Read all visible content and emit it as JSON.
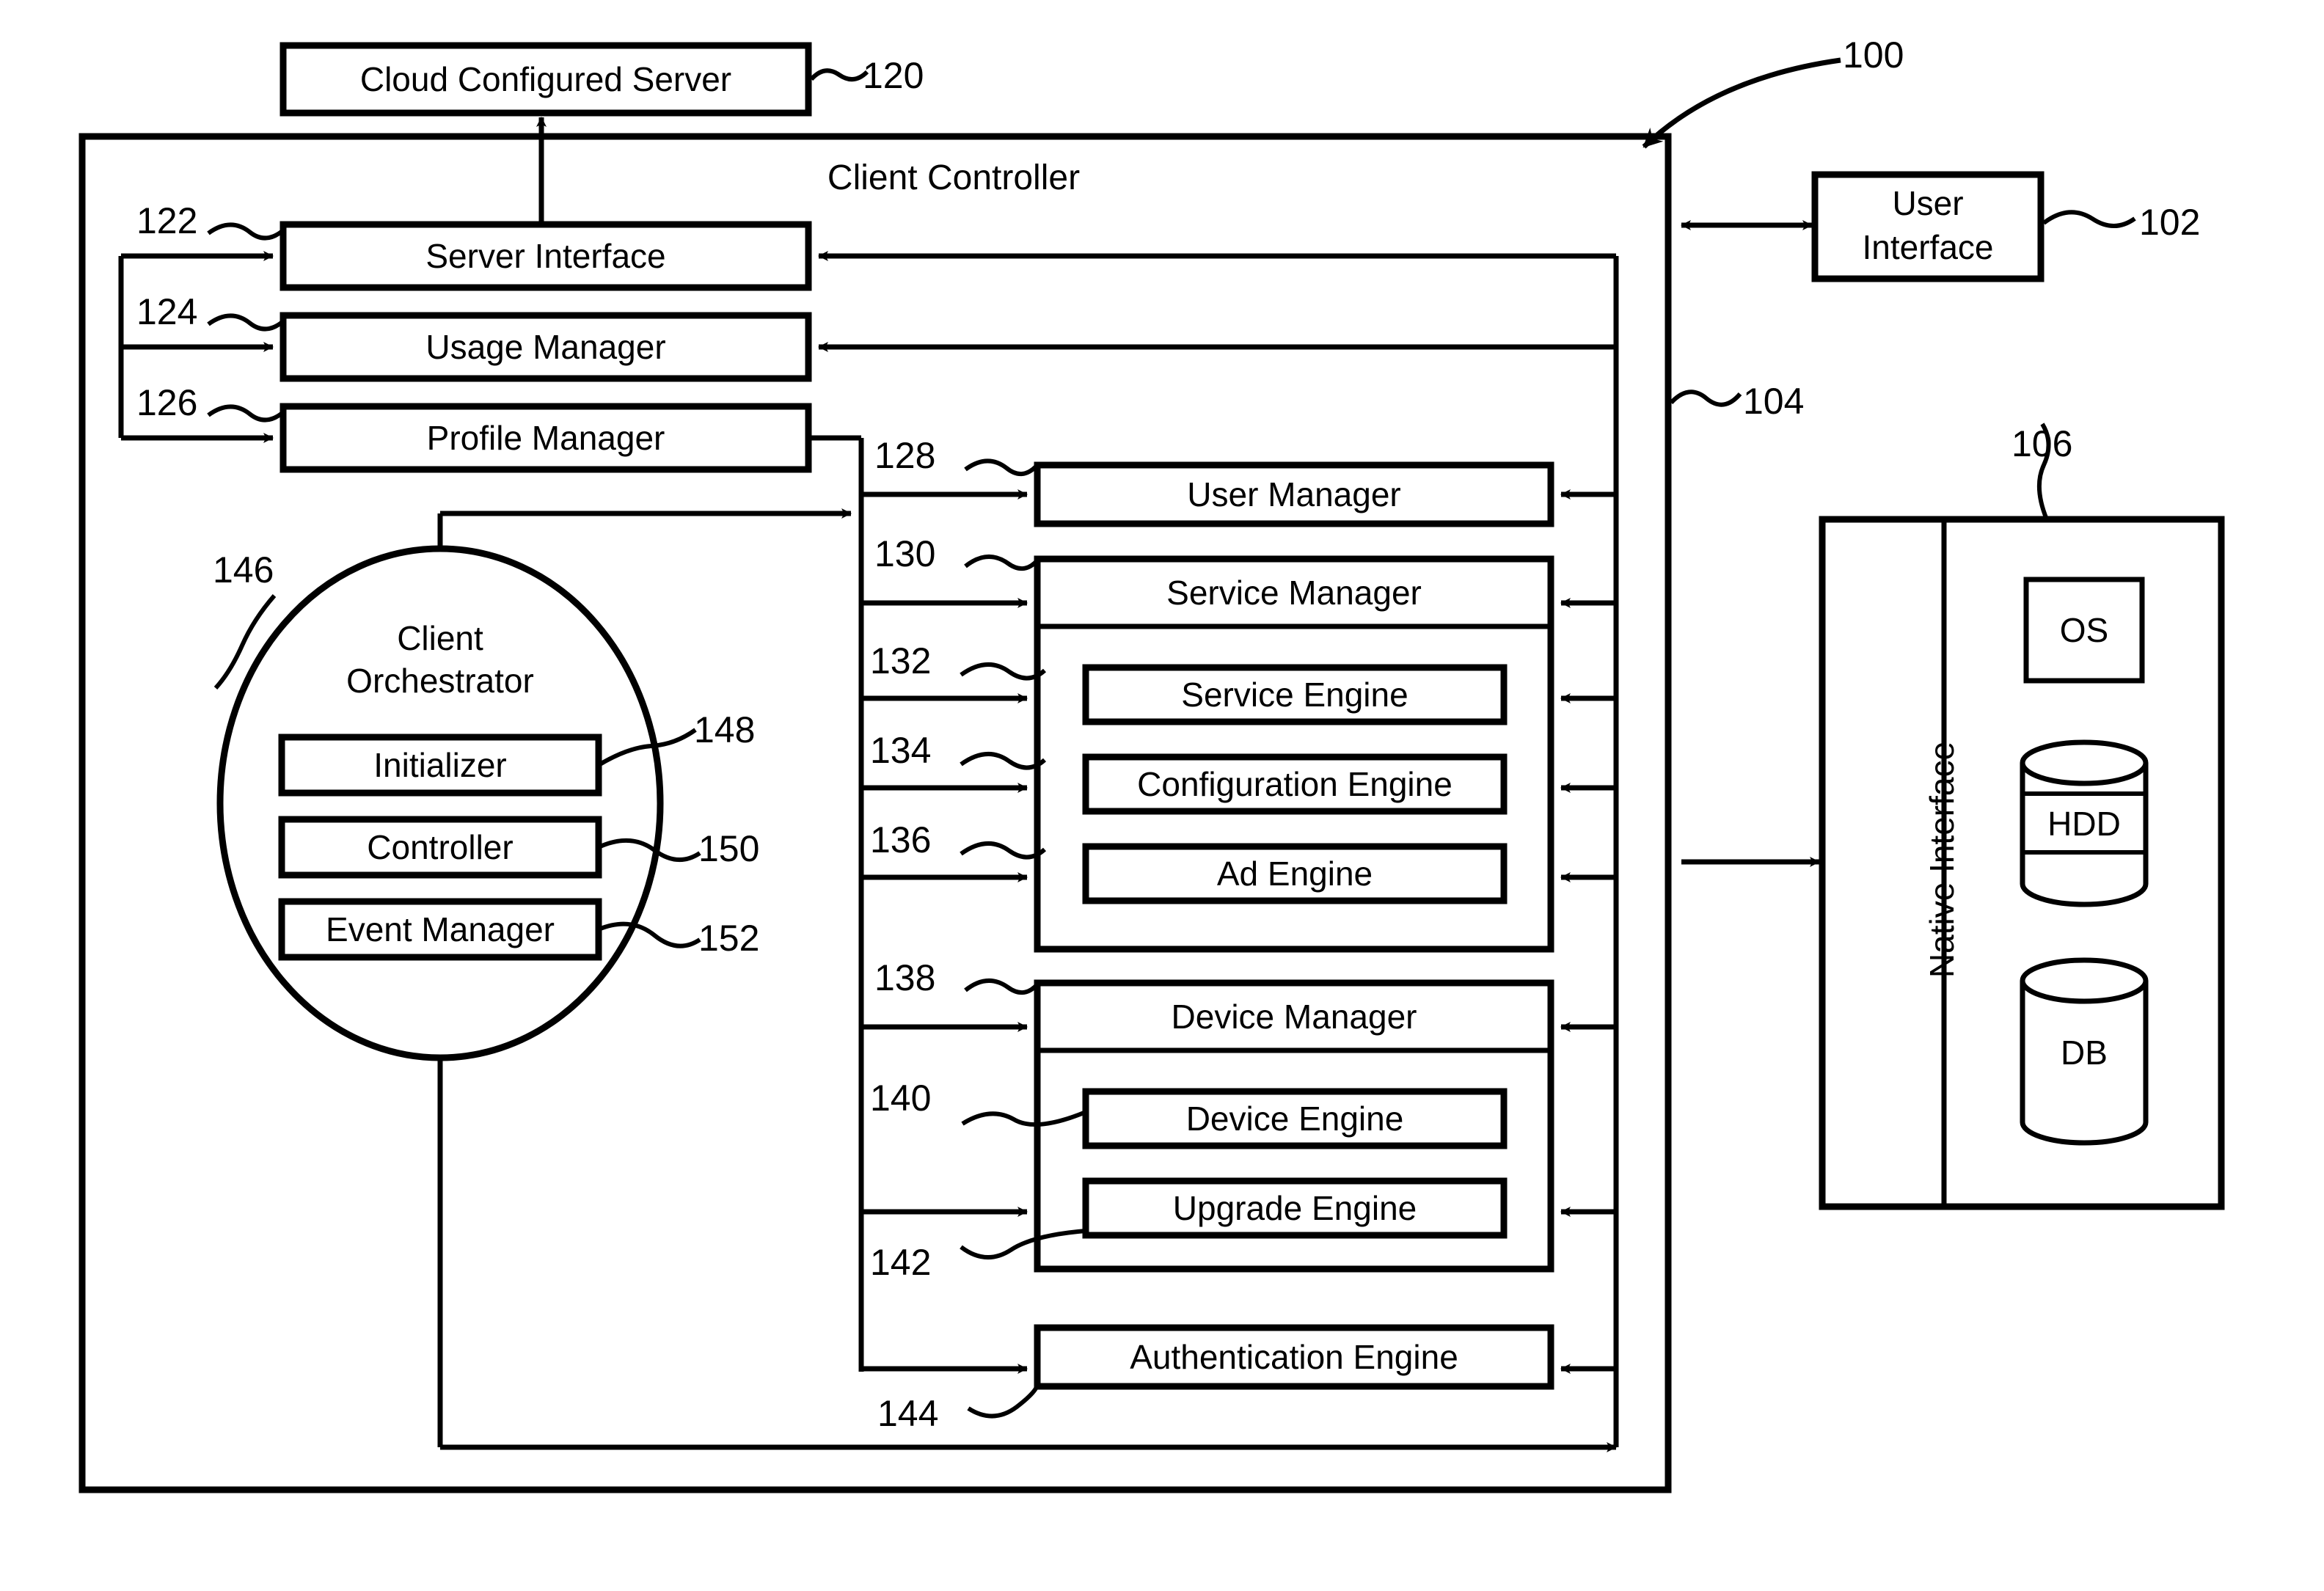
{
  "figure": {
    "reference_number": "100",
    "outer_label": "100"
  },
  "cloud_server": {
    "label": "Cloud Configured Server",
    "ref": "120"
  },
  "client_controller": {
    "title": "Client Controller",
    "ref": "104"
  },
  "user_interface": {
    "label_line1": "User",
    "label_line2": "Interface",
    "ref": "102"
  },
  "native_system": {
    "interface_label": "Native Interface",
    "ref": "106",
    "components": [
      {
        "label": "OS",
        "shape": "rect"
      },
      {
        "label": "HDD",
        "shape": "cylinder"
      },
      {
        "label": "DB",
        "shape": "cylinder"
      }
    ]
  },
  "left_column": [
    {
      "label": "Server Interface",
      "ref": "122"
    },
    {
      "label": "Usage Manager",
      "ref": "124"
    },
    {
      "label": "Profile Manager",
      "ref": "126"
    }
  ],
  "orchestrator": {
    "title_line1": "Client",
    "title_line2": "Orchestrator",
    "ref": "146",
    "items": [
      {
        "label": "Initializer",
        "ref": "148"
      },
      {
        "label": "Controller",
        "ref": "150"
      },
      {
        "label": "Event Manager",
        "ref": "152"
      }
    ]
  },
  "right_column": {
    "user_manager": {
      "label": "User Manager",
      "ref": "128"
    },
    "service_manager": {
      "label": "Service Manager",
      "ref": "130",
      "engines": [
        {
          "label": "Service Engine",
          "ref": "132"
        },
        {
          "label": "Configuration Engine",
          "ref": "134"
        },
        {
          "label": "Ad Engine",
          "ref": "136"
        }
      ]
    },
    "device_manager": {
      "label": "Device Manager",
      "ref": "138",
      "engines": [
        {
          "label": "Device Engine",
          "ref": "140"
        },
        {
          "label": "Upgrade Engine",
          "ref": "142"
        }
      ]
    },
    "authentication_engine": {
      "label": "Authentication Engine",
      "ref": "144"
    }
  },
  "colors": {
    "stroke": "#000000",
    "background": "#ffffff"
  }
}
